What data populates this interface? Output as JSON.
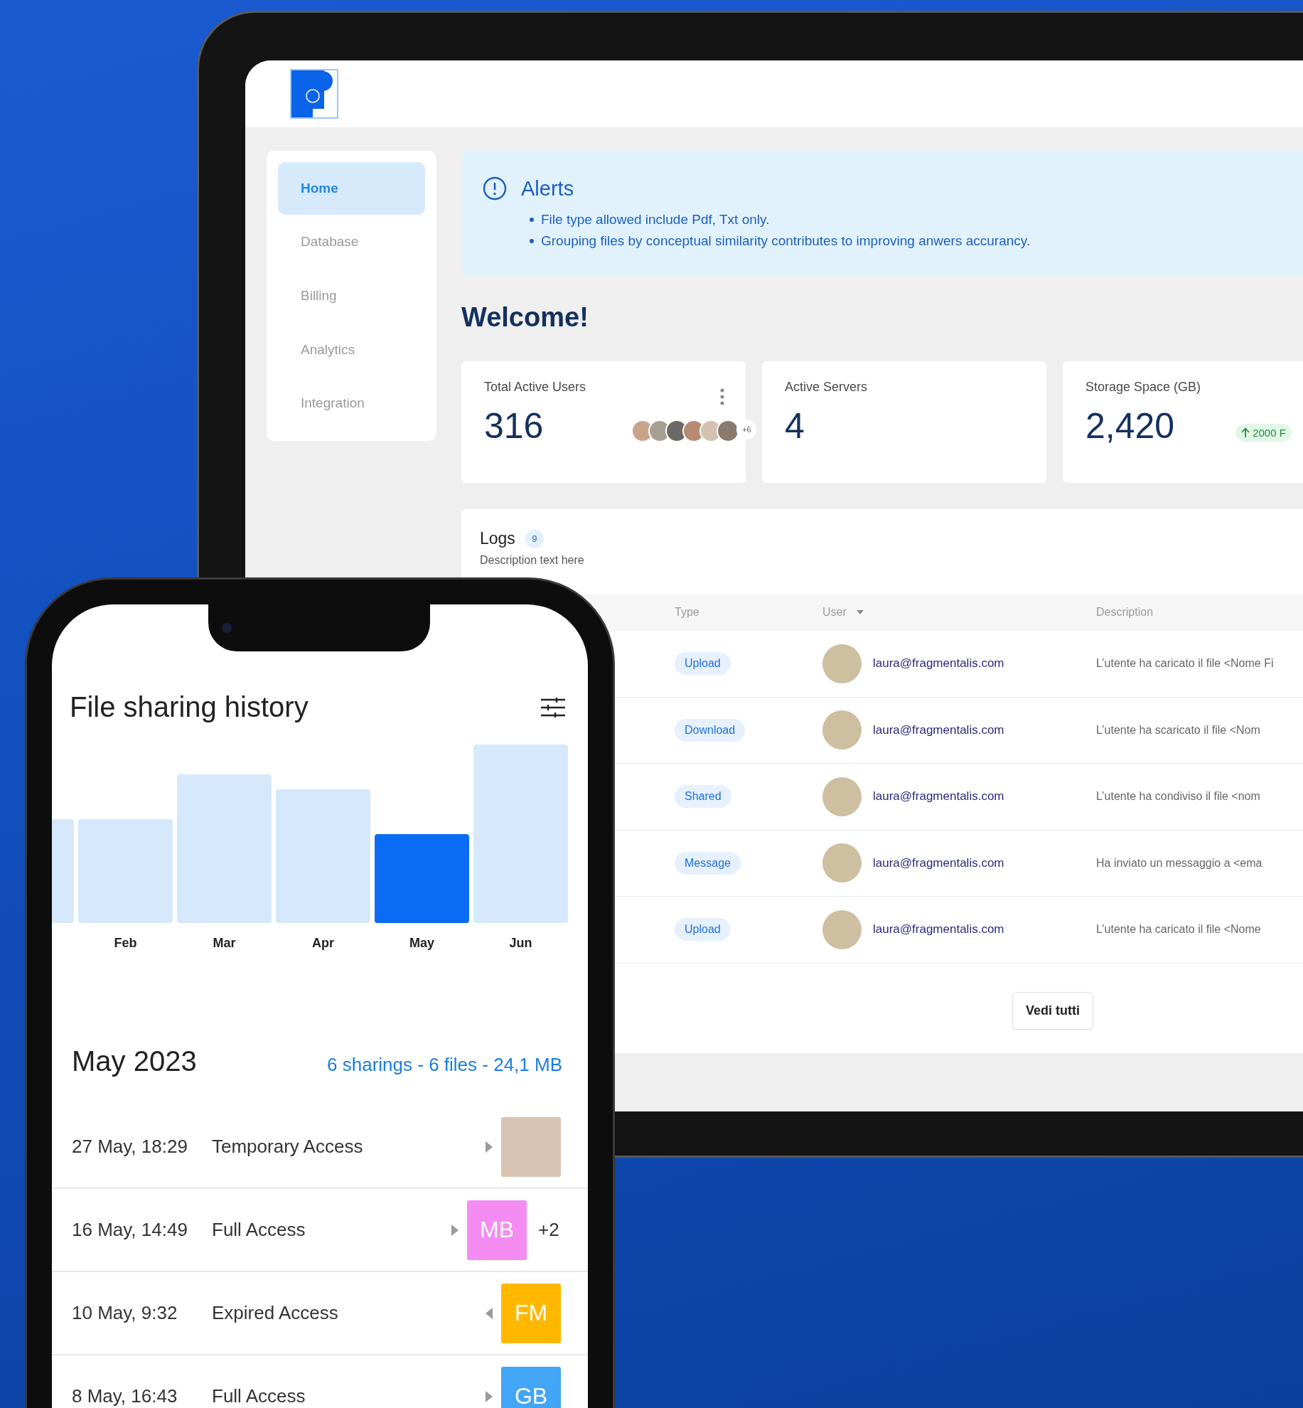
{
  "tablet": {
    "sidebar": {
      "items": [
        {
          "label": "Home",
          "selected": true
        },
        {
          "label": "Database",
          "selected": false
        },
        {
          "label": "Billing",
          "selected": false
        },
        {
          "label": "Analytics",
          "selected": false
        },
        {
          "label": "Integration",
          "selected": false
        }
      ]
    },
    "alerts": {
      "title": "Alerts",
      "items": [
        "File type allowed include Pdf, Txt only.",
        "Grouping files by conceptual similarity contributes to improving anwers accurancy."
      ]
    },
    "welcome": "Welcome!",
    "stats": [
      {
        "kind": "users",
        "title": "Total Active Users",
        "value": "316",
        "more": "+6"
      },
      {
        "kind": "plain",
        "title": "Active Servers",
        "value": "4"
      },
      {
        "kind": "trend",
        "title": "Storage Space (GB)",
        "value": "2,420",
        "trend": "2000 F"
      }
    ],
    "logs": {
      "title": "Logs",
      "count": "9",
      "description": "Description text here",
      "columns": [
        {
          "label": "Type",
          "sorted": false
        },
        {
          "label": "User",
          "sorted": true
        },
        {
          "label": "Description",
          "sorted": false
        }
      ],
      "rows": [
        {
          "type": "Upload",
          "email": "laura@fragmentalis.com",
          "description": "L’utente ha caricato il file <Nome Fi"
        },
        {
          "type": "Download",
          "email": "laura@fragmentalis.com",
          "description": "L’utente ha scaricato il file <Nom"
        },
        {
          "type": "Shared",
          "email": "laura@fragmentalis.com",
          "description": "L’utente  ha condiviso il file <nom"
        },
        {
          "type": "Message",
          "email": "laura@fragmentalis.com",
          "description": "Ha inviato un messaggio a <ema"
        },
        {
          "type": "Upload",
          "email": "laura@fragmentalis.com",
          "description": "L’utente ha caricato il file <Nome"
        }
      ],
      "button": "Vedi tutti"
    }
  },
  "phone": {
    "title": "File sharing history",
    "months": [
      {
        "label": "Feb",
        "selected": false
      },
      {
        "label": "Mar",
        "selected": false
      },
      {
        "label": "Apr",
        "selected": false
      },
      {
        "label": "May",
        "selected": true
      },
      {
        "label": "Jun",
        "selected": false
      }
    ],
    "month_title": "May 2023",
    "summary": "6 sharings - 6 files - 24,1 MB",
    "sharings": [
      {
        "date": "27 May, 18:29",
        "access": "Temporary Access",
        "expired": false,
        "kind": "photo"
      },
      {
        "date": "16 May, 14:49",
        "access": "Full Access",
        "expired": false,
        "kind": "initials",
        "initials": "MB",
        "color": "#f48cf2",
        "extra": "+2"
      },
      {
        "date": "10 May, 9:32",
        "access": "Expired Access",
        "expired": true,
        "kind": "initials",
        "initials": "FM",
        "color": "#ffb800"
      },
      {
        "date": "8 May, 16:43",
        "access": "Full Access",
        "expired": false,
        "kind": "initials",
        "initials": "GB",
        "color": "#42a5f5"
      }
    ]
  }
}
